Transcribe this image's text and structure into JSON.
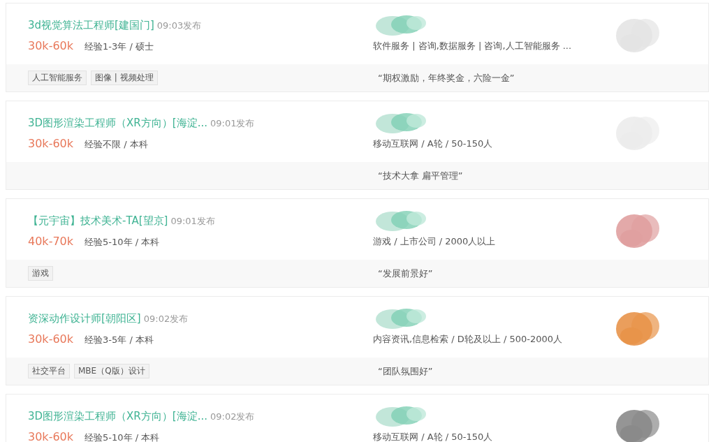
{
  "jobs": [
    {
      "title": "3d视觉算法工程师[建国门]",
      "time": "09:03发布",
      "salary": "30k-60k",
      "requirements": "经验1-3年 / 硕士",
      "industry": "软件服务 | 咨询,数据服务 | 咨询,人工智能服务 ...",
      "tags": [
        "人工智能服务",
        "图像 | 视频处理"
      ],
      "quote": "“期权激励，年终奖金，六险一金”",
      "logo": {
        "color": "#e4e4e4"
      }
    },
    {
      "title": "3D图形渲染工程师（XR方向）[海淀...",
      "time": "09:01发布",
      "salary": "30k-60k",
      "requirements": "经验不限 / 本科",
      "industry": "移动互联网 / A轮 / 50-150人",
      "quote": "“技术大拿 扁平管理”",
      "logo": {
        "color": "#ececec"
      }
    },
    {
      "title": "【元宇宙】技术美术-TA[望京]",
      "time": "09:01发布",
      "salary": "40k-70k",
      "requirements": "经验5-10年 / 本科",
      "industry": "游戏 / 上市公司 / 2000人以上",
      "tags": [
        "游戏"
      ],
      "quote": "“发展前景好”",
      "logo": {
        "color": "#e0a0a0"
      }
    },
    {
      "title": "资深动作设计师[朝阳区]",
      "time": "09:02发布",
      "salary": "30k-60k",
      "requirements": "经验3-5年 / 本科",
      "industry": "内容资讯,信息检索 / D轮及以上 / 500-2000人",
      "tags": [
        "社交平台",
        "MBE（Q版）设计"
      ],
      "quote": "“团队氛围好”",
      "logo": {
        "color": "#e8944a"
      }
    },
    {
      "title": "3D图形渲染工程师（XR方向）[海淀...",
      "time": "09:02发布",
      "salary": "30k-60k",
      "requirements": "经验5-10年 / 本科",
      "industry": "移动互联网 / A轮 / 50-150人",
      "logo": {
        "color": "#8a8a8a"
      }
    }
  ]
}
